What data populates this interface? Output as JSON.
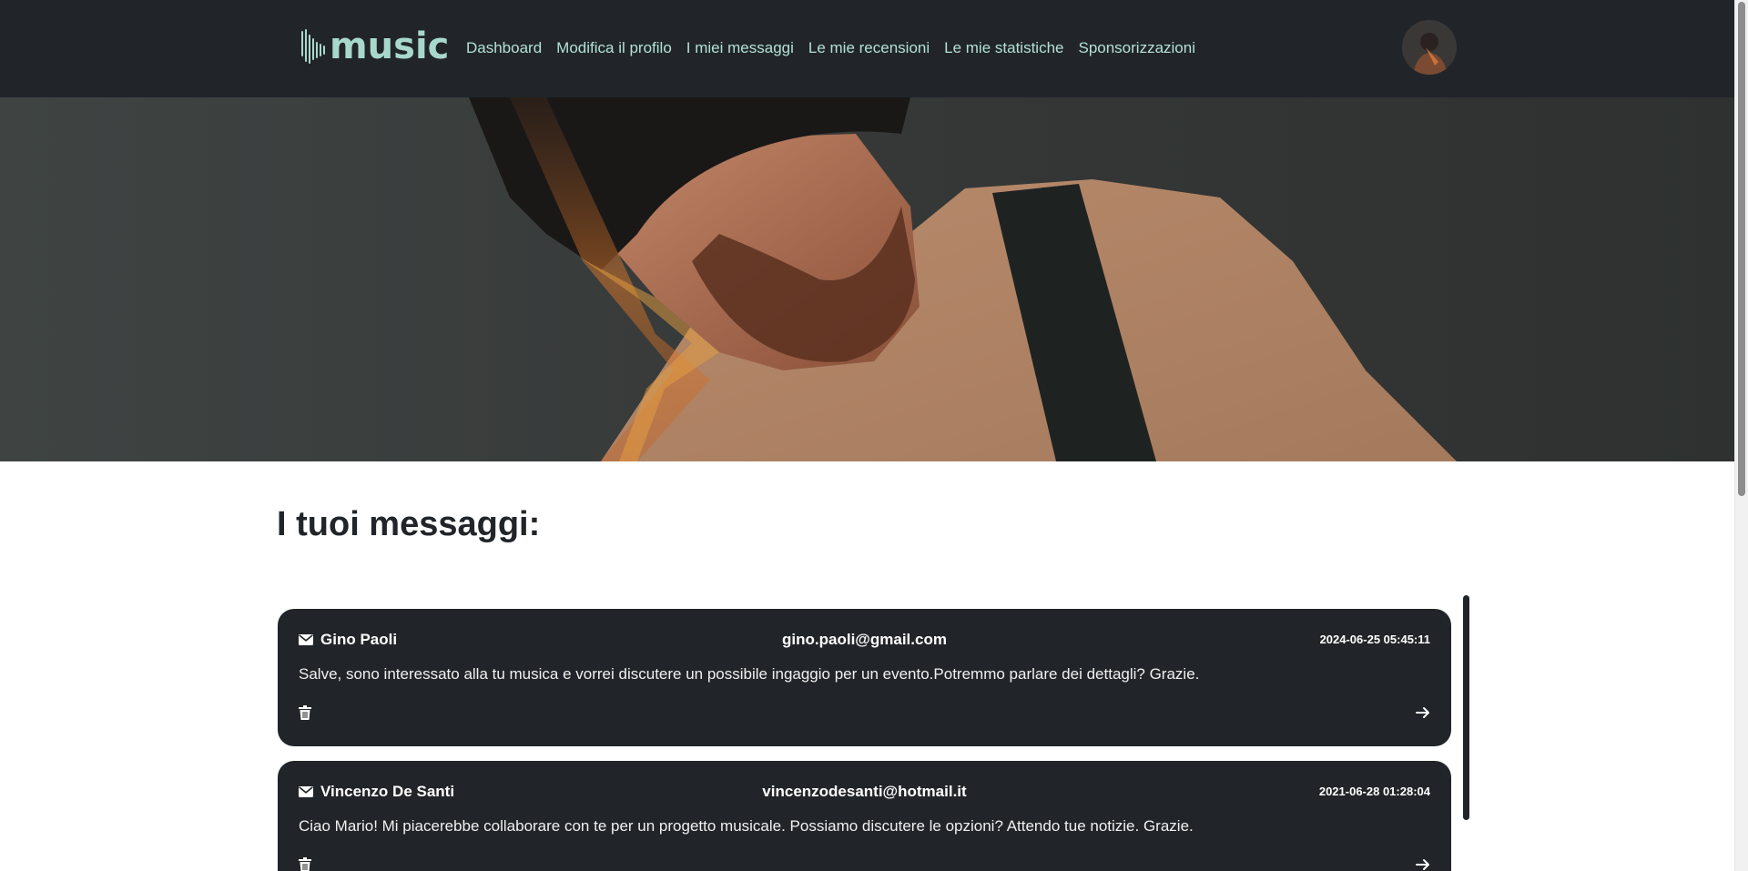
{
  "brand": {
    "name": "music",
    "logo_icon": "sound-wave-icon",
    "color": "#a8d8cc"
  },
  "nav": {
    "items": [
      {
        "label": "Dashboard"
      },
      {
        "label": "Modifica il profilo"
      },
      {
        "label": "I miei messaggi"
      },
      {
        "label": "Le mie recensioni"
      },
      {
        "label": "Le mie statistiche"
      },
      {
        "label": "Sponsorizzazioni"
      }
    ],
    "link_color": "#b3e0d4",
    "background": "#212529"
  },
  "hero": {
    "image": "musician-playing-guitar-photo"
  },
  "page": {
    "title": "I tuoi messaggi:"
  },
  "messages": [
    {
      "sender": "Gino Paoli",
      "email": "gino.paoli@gmail.com",
      "date": "2024-06-25 05:45:11",
      "text": "Salve, sono interessato alla tu musica e vorrei discutere un possibile ingaggio per un evento.Potremmo parlare dei dettagli? Grazie."
    },
    {
      "sender": "Vincenzo De Santi",
      "email": "vincenzodesanti@hotmail.it",
      "date": "2021-06-28 01:28:04",
      "text": "Ciao Mario! Mi piacerebbe collaborare con te per un progetto musicale. Possiamo discutere le opzioni? Attendo tue notizie. Grazie."
    }
  ],
  "icons": {
    "sender": "envelope-icon",
    "delete": "trash-icon",
    "open": "arrow-right-icon"
  }
}
